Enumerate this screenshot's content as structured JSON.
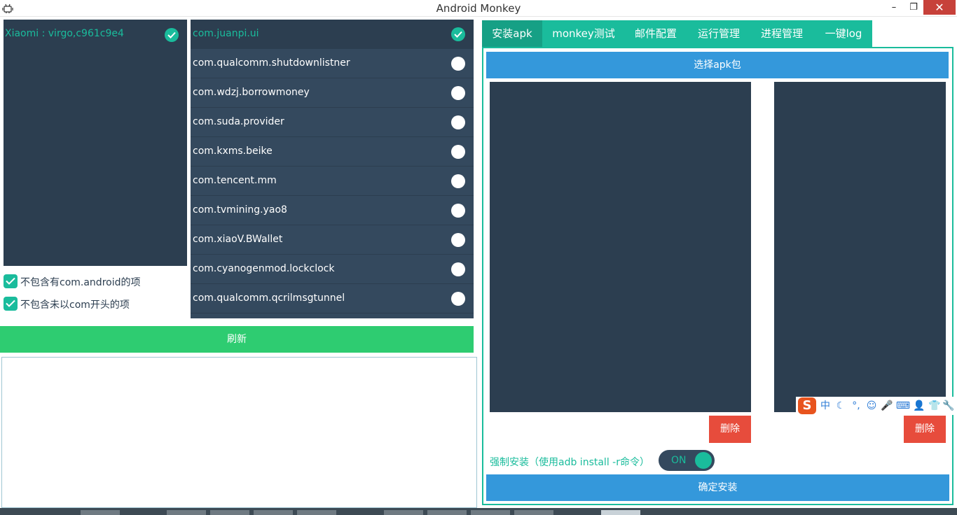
{
  "window": {
    "title": "Android Monkey",
    "minimize_glyph": "–",
    "restore_glyph": "❐",
    "close_glyph": "✕"
  },
  "devices": [
    {
      "label": "Xiaomi : virgo,c961c9e4",
      "selected": true
    }
  ],
  "filters": [
    {
      "label": "不包含有com.android的项",
      "checked": true
    },
    {
      "label": "不包含未以com开头的项",
      "checked": true
    }
  ],
  "packages": [
    {
      "label": "com.juanpi.ui",
      "selected": true
    },
    {
      "label": "com.qualcomm.shutdownlistner",
      "selected": false
    },
    {
      "label": "com.wdzj.borrowmoney",
      "selected": false
    },
    {
      "label": "com.suda.provider",
      "selected": false
    },
    {
      "label": "com.kxms.beike",
      "selected": false
    },
    {
      "label": "com.tencent.mm",
      "selected": false
    },
    {
      "label": "com.tvmining.yao8",
      "selected": false
    },
    {
      "label": "com.xiaoV.BWallet",
      "selected": false
    },
    {
      "label": "com.cyanogenmod.lockclock",
      "selected": false
    },
    {
      "label": "com.qualcomm.qcrilmsgtunnel",
      "selected": false
    }
  ],
  "refresh_label": "刷新",
  "tabs": [
    {
      "label": "安装apk",
      "active": true
    },
    {
      "label": "monkey测试",
      "active": false
    },
    {
      "label": "邮件配置",
      "active": false
    },
    {
      "label": "运行管理",
      "active": false
    },
    {
      "label": "进程管理",
      "active": false
    },
    {
      "label": "一键log",
      "active": false
    }
  ],
  "install": {
    "select_apk_label": "选择apk包",
    "delete_label": "删除",
    "force_install_label": "强制安装（使用adb install -r命令）",
    "toggle_state": "ON",
    "confirm_label": "确定安装"
  },
  "ime_toolbar": {
    "logo": "S",
    "items": [
      "中",
      "☾",
      "°,",
      "☺",
      "🎤",
      "⌨",
      "👤",
      "👕",
      "🔧"
    ]
  },
  "colors": {
    "accent": "#1abc9c",
    "dark_panel": "#2c3e50",
    "list_item": "#34495e",
    "refresh_green": "#2ecc71",
    "button_blue": "#3498db",
    "delete_red": "#e74c3c"
  }
}
